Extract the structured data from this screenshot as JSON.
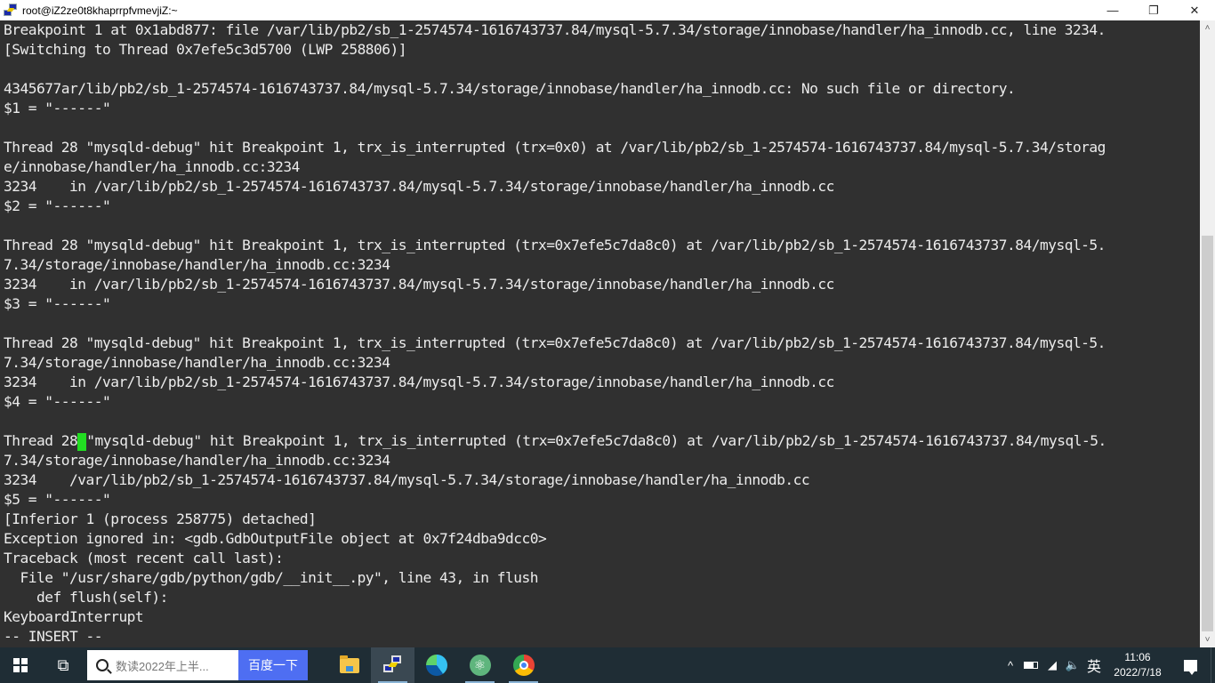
{
  "window": {
    "title": "root@iZ2ze0t8khaprrpfvmevjiZ:~",
    "controls": {
      "minimize": "—",
      "maximize": "❐",
      "close": "✕"
    }
  },
  "terminal": {
    "lines": [
      "Breakpoint 1 at 0x1abd877: file /var/lib/pb2/sb_1-2574574-1616743737.84/mysql-5.7.34/storage/innobase/handler/ha_innodb.cc, line 3234.",
      "[Switching to Thread 0x7efe5c3d5700 (LWP 258806)]",
      "",
      "4345677ar/lib/pb2/sb_1-2574574-1616743737.84/mysql-5.7.34/storage/innobase/handler/ha_innodb.cc: No such file or directory.",
      "$1 = \"------\"",
      "",
      "Thread 28 \"mysqld-debug\" hit Breakpoint 1, trx_is_interrupted (trx=0x0) at /var/lib/pb2/sb_1-2574574-1616743737.84/mysql-5.7.34/storag",
      "e/innobase/handler/ha_innodb.cc:3234",
      "3234    in /var/lib/pb2/sb_1-2574574-1616743737.84/mysql-5.7.34/storage/innobase/handler/ha_innodb.cc",
      "$2 = \"------\"",
      "",
      "Thread 28 \"mysqld-debug\" hit Breakpoint 1, trx_is_interrupted (trx=0x7efe5c7da8c0) at /var/lib/pb2/sb_1-2574574-1616743737.84/mysql-5.",
      "7.34/storage/innobase/handler/ha_innodb.cc:3234",
      "3234    in /var/lib/pb2/sb_1-2574574-1616743737.84/mysql-5.7.34/storage/innobase/handler/ha_innodb.cc",
      "$3 = \"------\"",
      "",
      "Thread 28 \"mysqld-debug\" hit Breakpoint 1, trx_is_interrupted (trx=0x7efe5c7da8c0) at /var/lib/pb2/sb_1-2574574-1616743737.84/mysql-5.",
      "7.34/storage/innobase/handler/ha_innodb.cc:3234",
      "3234    in /var/lib/pb2/sb_1-2574574-1616743737.84/mysql-5.7.34/storage/innobase/handler/ha_innodb.cc",
      "$4 = \"------\"",
      ""
    ],
    "cursor_line": {
      "before": "Thread 28",
      "after": "\"mysqld-debug\" hit Breakpoint 1, trx_is_interrupted (trx=0x7efe5c7da8c0) at /var/lib/pb2/sb_1-2574574-1616743737.84/mysql-5."
    },
    "lines_after": [
      "7.34/storage/innobase/handler/ha_innodb.cc:3234",
      "3234    /var/lib/pb2/sb_1-2574574-1616743737.84/mysql-5.7.34/storage/innobase/handler/ha_innodb.cc",
      "$5 = \"------\"",
      "[Inferior 1 (process 258775) detached]",
      "Exception ignored in: <gdb.GdbOutputFile object at 0x7f24dba9dcc0>",
      "Traceback (most recent call last):",
      "  File \"/usr/share/gdb/python/gdb/__init__.py\", line 43, in flush",
      "    def flush(self):",
      "KeyboardInterrupt",
      "-- INSERT --"
    ],
    "colors": {
      "background": "#303030",
      "foreground": "#ececec",
      "cursor": "#22dd22"
    }
  },
  "scrollbar": {
    "up_arrow": "˄",
    "down_arrow": "˅"
  },
  "taskbar": {
    "search_placeholder": "数读2022年上半...",
    "search_button": "百度一下",
    "taskview_glyph": "⧉",
    "apps": [
      {
        "name": "File Explorer",
        "icon": "folder-icon"
      },
      {
        "name": "PuTTY",
        "icon": "putty-icon",
        "active": true
      },
      {
        "name": "Microsoft Edge",
        "icon": "edge-icon"
      },
      {
        "name": "Atom",
        "icon": "atom-icon"
      },
      {
        "name": "Google Chrome",
        "icon": "chrome-icon"
      }
    ],
    "atom_glyph": "⚛",
    "tray": {
      "chevron": "^",
      "wifi": "◢",
      "volume": "🔈",
      "ime": "英",
      "time": "11:06",
      "date": "2022/7/18"
    },
    "colors": {
      "background": "#1f2d35",
      "search_button": "#4e6ef2"
    }
  }
}
